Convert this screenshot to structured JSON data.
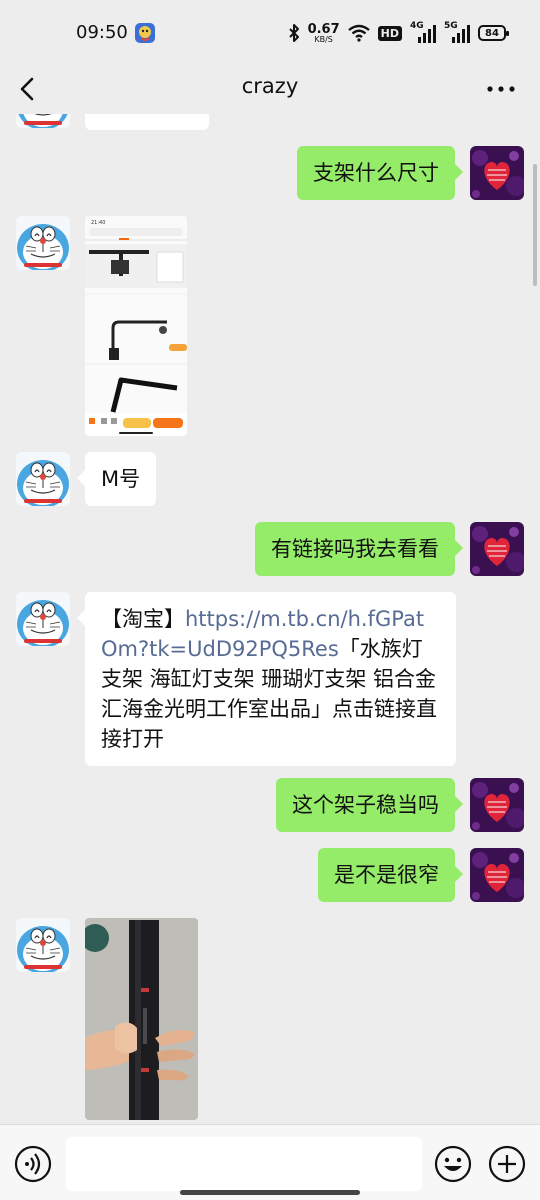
{
  "status_bar": {
    "time": "09:50",
    "net_speed_value": "0.67",
    "net_speed_unit": "KB/S",
    "hd_label": "HD",
    "signal1_label": "4G",
    "signal2_label": "5G",
    "battery": "84"
  },
  "header": {
    "title": "crazy"
  },
  "messages": [
    {
      "from": "me",
      "type": "text",
      "text": "支架什么尺寸"
    },
    {
      "from": "them",
      "type": "image"
    },
    {
      "from": "them",
      "type": "text",
      "text": "M号"
    },
    {
      "from": "me",
      "type": "text",
      "text": "有链接吗我去看看"
    },
    {
      "from": "them",
      "type": "link",
      "prefix": "【淘宝】",
      "url": "https://m.tb.cn/h.fGPatOm?tk=UdD92PQ5Res",
      "suffix": "「水族灯支架 海缸灯支架 珊瑚灯支架 铝合金 汇海金光明工作室出品」点击链接直接打开"
    },
    {
      "from": "me",
      "type": "text",
      "text": "这个架子稳当吗"
    },
    {
      "from": "me",
      "type": "text",
      "text": "是不是很窄"
    },
    {
      "from": "them",
      "type": "image"
    }
  ],
  "screenshot_thumb": {
    "time": "21:40"
  },
  "colors": {
    "outgoing_bubble": "#95ec69",
    "incoming_bubble": "#ffffff",
    "background": "#ededed",
    "link": "#576b95"
  }
}
